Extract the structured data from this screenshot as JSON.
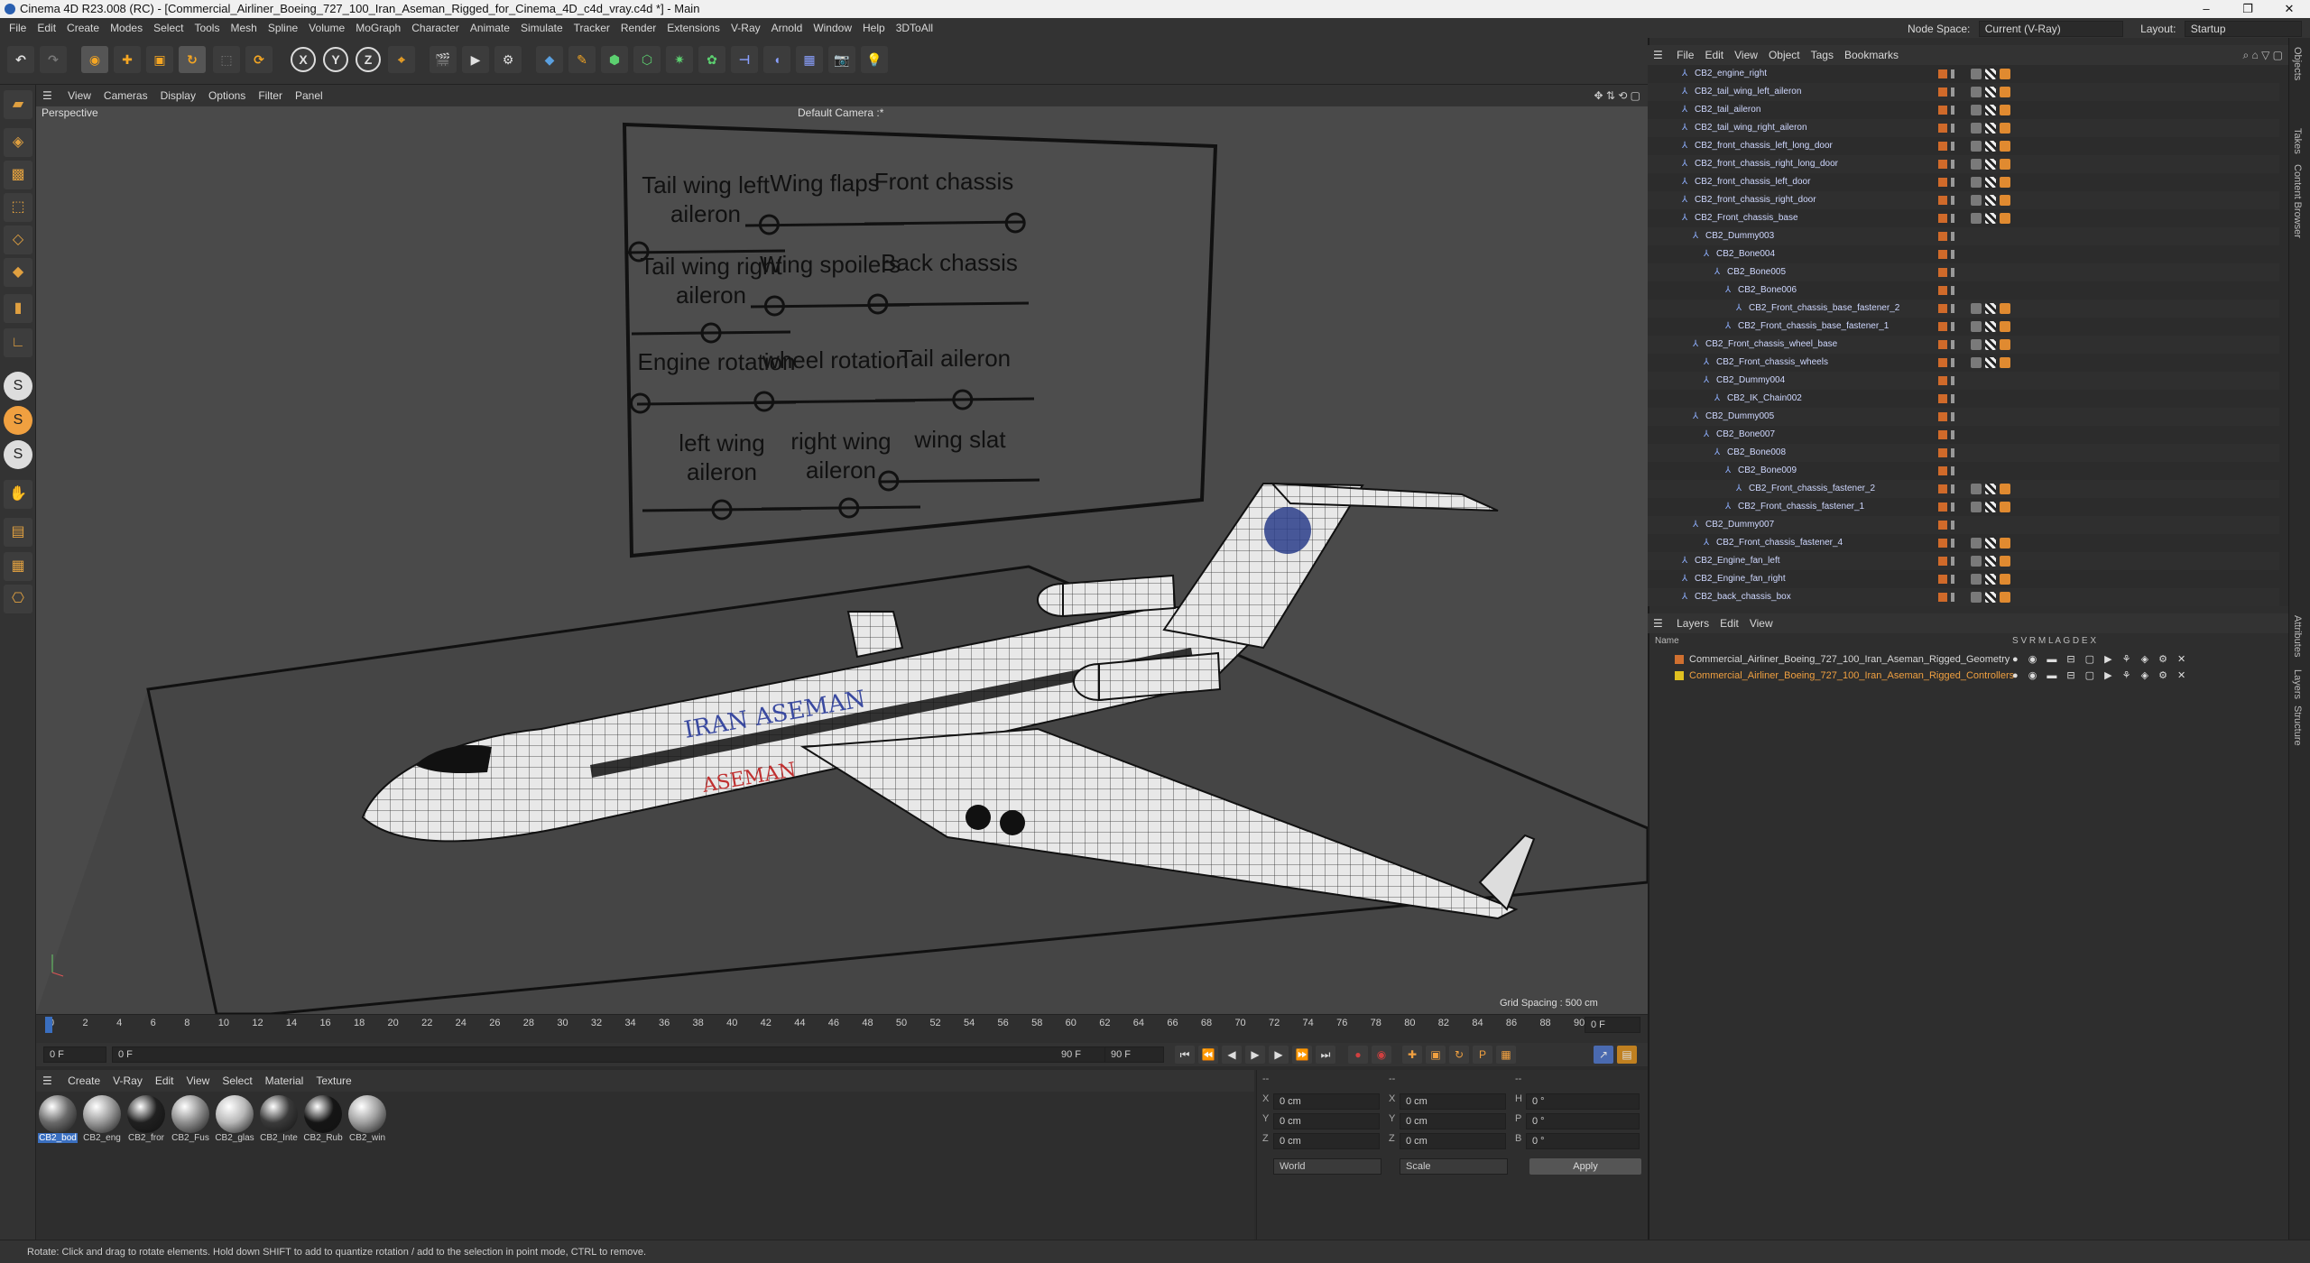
{
  "window": {
    "title": "Cinema 4D R23.008 (RC) - [Commercial_Airliner_Boeing_727_100_Iran_Aseman_Rigged_for_Cinema_4D_c4d_vray.c4d *] - Main",
    "minimize": "–",
    "maximize": "❐",
    "close": "✕"
  },
  "menu": [
    "File",
    "Edit",
    "Create",
    "Modes",
    "Select",
    "Tools",
    "Mesh",
    "Spline",
    "Volume",
    "MoGraph",
    "Character",
    "Animate",
    "Simulate",
    "Tracker",
    "Render",
    "Extensions",
    "V-Ray",
    "Arnold",
    "Window",
    "Help",
    "3DToAll"
  ],
  "nodespace": {
    "label": "Node Space:",
    "value": "Current (V-Ray)",
    "layout_label": "Layout:",
    "layout_value": "Startup"
  },
  "toolbar": {
    "axis": [
      "X",
      "Y",
      "Z"
    ]
  },
  "viewport": {
    "menu": [
      "View",
      "Cameras",
      "Display",
      "Options",
      "Filter",
      "Panel"
    ],
    "projection": "Perspective",
    "camera": "Default Camera :*",
    "grid_spacing": "Grid Spacing : 500 cm",
    "board_labels": [
      {
        "text": "Tail wing left aileron",
        "x": 0.08
      },
      {
        "text": "Wing flaps",
        "x": 0.15
      },
      {
        "text": "Front chassis",
        "x": 0.95
      },
      {
        "text": "Tail wing right aileron",
        "x": 0.5
      },
      {
        "text": "Wing spoilers",
        "x": 0.15
      },
      {
        "text": "Back chassis",
        "x": 0.05
      },
      {
        "text": "Engine rotation",
        "x": 0.02
      },
      {
        "text": "wheel rotation",
        "x": 0.05
      },
      {
        "text": "Tail aileron",
        "x": 0.55
      },
      {
        "text": "left wing aileron",
        "x": 0.5
      },
      {
        "text": "right wing aileron",
        "x": 0.55
      },
      {
        "text": "wing slat",
        "x": 0.05
      }
    ]
  },
  "timeline": {
    "ticks": [
      "0",
      "2",
      "4",
      "6",
      "8",
      "10",
      "12",
      "14",
      "16",
      "18",
      "20",
      "22",
      "24",
      "26",
      "28",
      "30",
      "32",
      "34",
      "36",
      "38",
      "40",
      "42",
      "44",
      "46",
      "48",
      "50",
      "52",
      "54",
      "56",
      "58",
      "60",
      "62",
      "64",
      "66",
      "68",
      "70",
      "72",
      "74",
      "76",
      "78",
      "80",
      "82",
      "84",
      "86",
      "88",
      "90"
    ],
    "current_frame": "0 F",
    "start": "0 F",
    "start2": "0 F",
    "end": "90 F",
    "end2": "90 F"
  },
  "materials": {
    "menu": [
      "Create",
      "V-Ray",
      "Edit",
      "View",
      "Select",
      "Material",
      "Texture"
    ],
    "items": [
      {
        "name": "CB2_bod",
        "color": "#6a6a6a"
      },
      {
        "name": "CB2_eng",
        "color": "#9a9a9a"
      },
      {
        "name": "CB2_fror",
        "color": "#202020"
      },
      {
        "name": "CB2_Fus",
        "color": "#8e8e8e"
      },
      {
        "name": "CB2_glas",
        "color": "#b8b8b8"
      },
      {
        "name": "CB2_Inte",
        "color": "#3a3a3a"
      },
      {
        "name": "CB2_Rub",
        "color": "#151515"
      },
      {
        "name": "CB2_win",
        "color": "#a0a0a0"
      }
    ]
  },
  "attributes": {
    "x_pos": "0 cm",
    "y_pos": "0 cm",
    "z_pos": "0 cm",
    "x_size": "0 cm",
    "y_size": "0 cm",
    "z_size": "0 cm",
    "h": "0 °",
    "p": "0 °",
    "b": "0 °",
    "labels_pos": [
      "X",
      "Y",
      "Z"
    ],
    "labels_size": [
      "X",
      "Y",
      "Z"
    ],
    "labels_rot": [
      "H",
      "P",
      "B"
    ],
    "coord_mode": "World",
    "size_mode": "Scale",
    "apply": "Apply",
    "header_left": "--",
    "header_mid": "--",
    "header_right": "--"
  },
  "objects": {
    "menu": [
      "File",
      "Edit",
      "View",
      "Object",
      "Tags",
      "Bookmarks"
    ],
    "rows": [
      {
        "name": "CB2_engine_right",
        "indent": 0
      },
      {
        "name": "CB2_tail_wing_left_aileron",
        "indent": 0
      },
      {
        "name": "CB2_tail_aileron",
        "indent": 0
      },
      {
        "name": "CB2_tail_wing_right_aileron",
        "indent": 0
      },
      {
        "name": "CB2_front_chassis_left_long_door",
        "indent": 0
      },
      {
        "name": "CB2_front_chassis_right_long_door",
        "indent": 0
      },
      {
        "name": "CB2_front_chassis_left_door",
        "indent": 0
      },
      {
        "name": "CB2_front_chassis_right_door",
        "indent": 0
      },
      {
        "name": "CB2_Front_chassis_base",
        "indent": 0
      },
      {
        "name": "CB2_Dummy003",
        "indent": 1
      },
      {
        "name": "CB2_Bone004",
        "indent": 2
      },
      {
        "name": "CB2_Bone005",
        "indent": 3
      },
      {
        "name": "CB2_Bone006",
        "indent": 4
      },
      {
        "name": "CB2_Front_chassis_base_fastener_2",
        "indent": 5
      },
      {
        "name": "CB2_Front_chassis_base_fastener_1",
        "indent": 4
      },
      {
        "name": "CB2_Front_chassis_wheel_base",
        "indent": 1
      },
      {
        "name": "CB2_Front_chassis_wheels",
        "indent": 2
      },
      {
        "name": "CB2_Dummy004",
        "indent": 2
      },
      {
        "name": "CB2_IK_Chain002",
        "indent": 3
      },
      {
        "name": "CB2_Dummy005",
        "indent": 1
      },
      {
        "name": "CB2_Bone007",
        "indent": 2
      },
      {
        "name": "CB2_Bone008",
        "indent": 3
      },
      {
        "name": "CB2_Bone009",
        "indent": 4
      },
      {
        "name": "CB2_Front_chassis_fastener_2",
        "indent": 5
      },
      {
        "name": "CB2_Front_chassis_fastener_1",
        "indent": 4
      },
      {
        "name": "CB2_Dummy007",
        "indent": 1
      },
      {
        "name": "CB2_Front_chassis_fastener_4",
        "indent": 2
      },
      {
        "name": "CB2_Engine_fan_left",
        "indent": 0
      },
      {
        "name": "CB2_Engine_fan_right",
        "indent": 0
      },
      {
        "name": "CB2_back_chassis_box",
        "indent": 0
      }
    ]
  },
  "layers": {
    "menu": [
      "Layers",
      "Edit",
      "View"
    ],
    "col_name": "Name",
    "col_flags": "S  V  R  M  L  A  G  D  E  X",
    "rows": [
      {
        "name": "Commercial_Airliner_Boeing_727_100_Iran_Aseman_Rigged_Geometry",
        "color": "#d07030",
        "text_color": "#d8d8d8"
      },
      {
        "name": "Commercial_Airliner_Boeing_727_100_Iran_Aseman_Rigged_Controllers",
        "color": "#e0c020",
        "text_color": "#f0a040"
      }
    ]
  },
  "side_tabs": [
    "Objects",
    "Takes",
    "Content Browser",
    "Attributes",
    "Layers",
    "Structure"
  ],
  "status": "Rotate: Click and drag to rotate elements. Hold down SHIFT to add to quantize rotation / add to the selection in point mode, CTRL to remove."
}
